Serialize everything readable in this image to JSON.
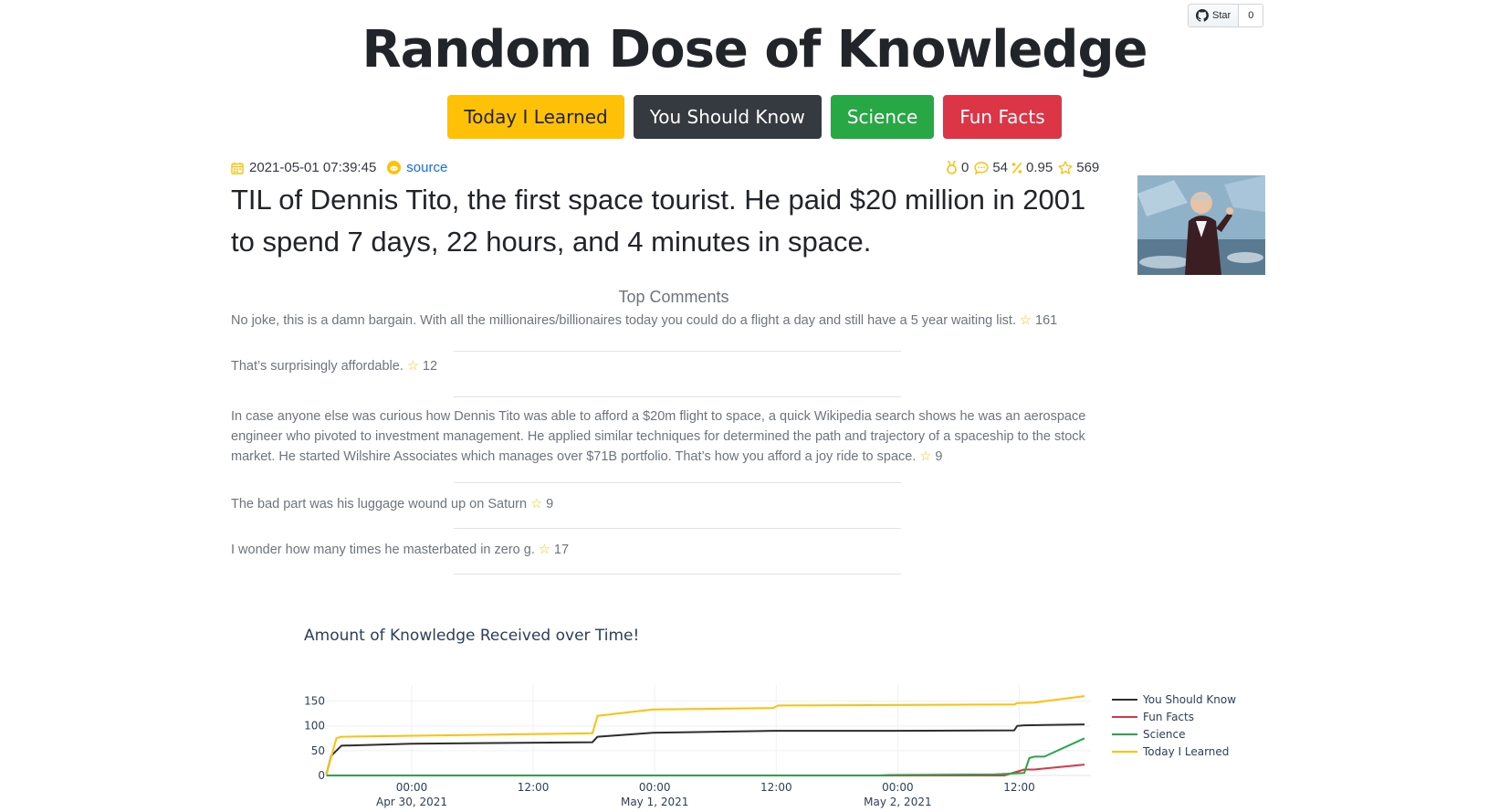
{
  "github": {
    "star_label": "Star",
    "count": "0"
  },
  "site_title": "Random Dose of Knowledge",
  "nav": [
    {
      "label": "Today I Learned",
      "color": "#ffc107"
    },
    {
      "label": "You Should Know",
      "color": "#343a40"
    },
    {
      "label": "Science",
      "color": "#28a745"
    },
    {
      "label": "Fun Facts",
      "color": "#dc3545"
    }
  ],
  "post": {
    "timestamp": "2021-05-01 07:39:45",
    "source_label": "source",
    "awards": "0",
    "comments": "54",
    "ratio": "0.95",
    "score": "569",
    "title": "TIL of Dennis Tito, the first space tourist. He paid $20 million in 2001 to spend 7 days, 22 hours, and 4 minutes in space."
  },
  "comments_heading": "Top Comments",
  "comments": [
    {
      "text": "No joke, this is a damn bargain. With all the millionaires/billionaires today you could do a flight a day and still have a 5 year waiting list.",
      "score": "161"
    },
    {
      "text": "That’s surprisingly affordable.",
      "score": "12"
    },
    {
      "text": "In case anyone else was curious how Dennis Tito was able to afford a $20m flight to space, a quick Wikipedia search shows he was an aerospace engineer who pivoted to investment management. He applied similar techniques for determined the path and trajectory of a spaceship to the stock market. He started Wilshire Associates which manages over $71B portfolio. That’s how you afford a joy ride to space.",
      "score": "9"
    },
    {
      "text": "The bad part was his luggage wound up on Saturn",
      "score": "9"
    },
    {
      "text": "I wonder how many times he masterbated in zero g.",
      "score": "17"
    }
  ],
  "chart_data": {
    "type": "line",
    "title": "Amount of Knowledge Received over Time!",
    "x_ticks": [
      "00:00",
      "12:00",
      "00:00",
      "12:00",
      "00:00",
      "12:00"
    ],
    "x_dates": [
      "Apr 30, 2021",
      "",
      "May 1, 2021",
      "",
      "May 2, 2021",
      ""
    ],
    "y_ticks": [
      "0",
      "50",
      "100",
      "150"
    ],
    "ylim": [
      0,
      175
    ],
    "legend_position": "right",
    "series": [
      {
        "name": "You Should Know",
        "color": "#2d2d2d",
        "x_hours": [
          -8.5,
          -8,
          -7,
          0,
          18,
          18.5,
          24,
          36,
          48,
          60,
          60.3,
          61,
          67
        ],
        "values": [
          2,
          40,
          60,
          64,
          67,
          78,
          86,
          90,
          90,
          91,
          100,
          101,
          103
        ]
      },
      {
        "name": "Fun Facts",
        "color": "#dc3545",
        "x_hours": [
          -8.5,
          24,
          48,
          59,
          61,
          62,
          67
        ],
        "values": [
          0,
          0,
          0,
          0,
          12,
          12,
          22
        ]
      },
      {
        "name": "Science",
        "color": "#28a745",
        "x_hours": [
          -8.5,
          24,
          46.5,
          47.5,
          58,
          61,
          61.5,
          62,
          63,
          67
        ],
        "values": [
          0,
          0,
          0,
          1,
          2,
          5,
          35,
          38,
          38,
          75
        ]
      },
      {
        "name": "Today I Learned",
        "color": "#ffc107",
        "x_hours": [
          -8.5,
          -7.5,
          -7,
          18,
          18.5,
          24,
          36,
          36.5,
          48,
          60,
          60.3,
          62,
          67
        ],
        "values": [
          2,
          75,
          78,
          85,
          120,
          133,
          136,
          141,
          142,
          143,
          146,
          147,
          160
        ]
      }
    ]
  }
}
